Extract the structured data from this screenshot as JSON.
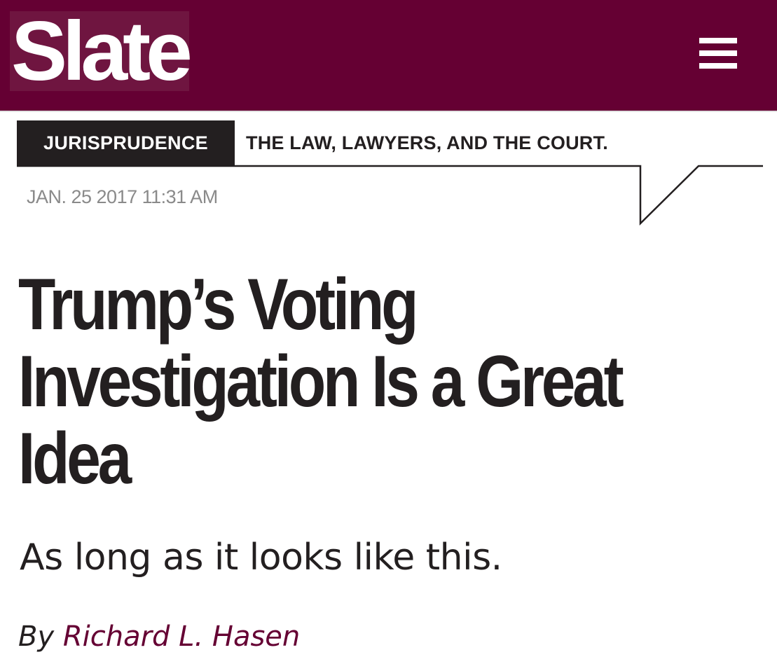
{
  "brand": {
    "logo_text": "Slate",
    "colors": {
      "brand": "#650033",
      "logo_bg": "#6f1540",
      "text": "#231f20",
      "muted": "#8a8a8a"
    }
  },
  "header": {
    "menu_icon": "hamburger-menu-icon"
  },
  "section": {
    "name": "JURISPRUDENCE",
    "description": "THE LAW, LAWYERS, AND THE COURT."
  },
  "article": {
    "date": "JAN. 25 2017 11:31 AM",
    "headline_lines": [
      "Trump’s Voting",
      "Investigation Is a Great",
      "Idea"
    ],
    "deck": "As long as it looks like this.",
    "byline_prefix": "By",
    "author": "Richard L. Hasen"
  }
}
